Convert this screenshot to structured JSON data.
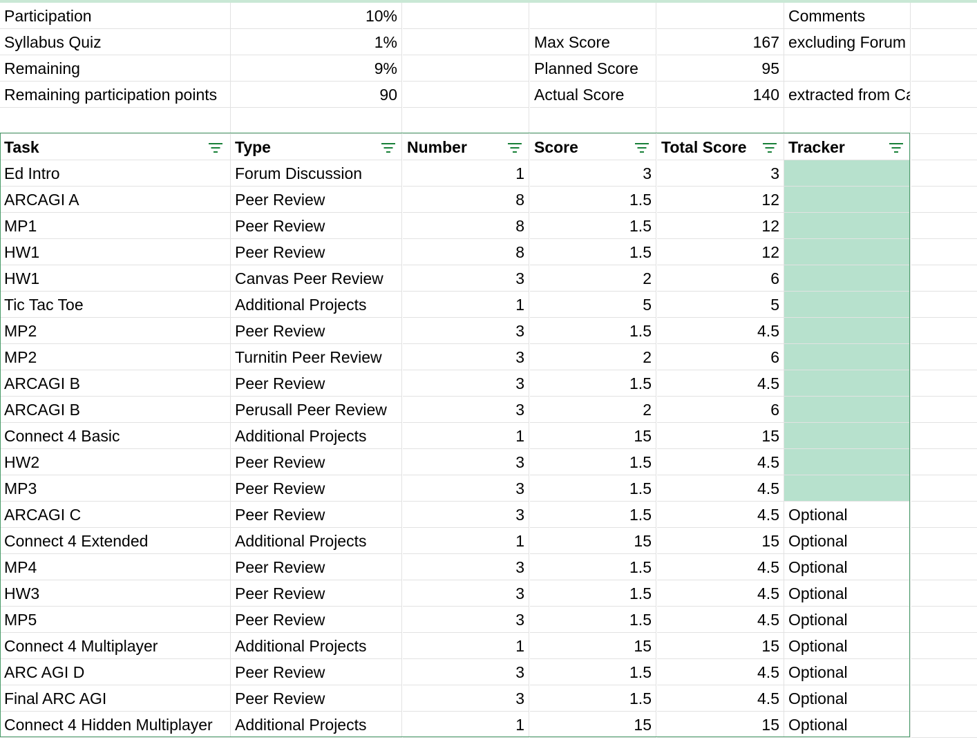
{
  "summary": {
    "rows": [
      {
        "a": "Participation",
        "b": "10%",
        "e": "",
        "f": "",
        "g": "Comments"
      },
      {
        "a": "Syllabus Quiz",
        "b": "1%",
        "e": "Max Score",
        "f": "167",
        "g": "excluding Forum posts"
      },
      {
        "a": "Remaining",
        "b": "9%",
        "e": "Planned Score",
        "f": "95",
        "g": ""
      },
      {
        "a": "Remaining participation points",
        "b": "90",
        "e": "Actual Score",
        "f": "140",
        "g": "extracted from Canvas"
      }
    ]
  },
  "table": {
    "headers": [
      "Task",
      "Type",
      "Number",
      "Score",
      "Total Score",
      "Tracker"
    ],
    "rows": [
      {
        "task": "Ed Intro",
        "type": "Forum Discussion",
        "number": "1",
        "score": "3",
        "total": "3",
        "tracker": "",
        "done": true
      },
      {
        "task": "ARCAGI A",
        "type": "Peer Review",
        "number": "8",
        "score": "1.5",
        "total": "12",
        "tracker": "",
        "done": true
      },
      {
        "task": "MP1",
        "type": "Peer Review",
        "number": "8",
        "score": "1.5",
        "total": "12",
        "tracker": "",
        "done": true
      },
      {
        "task": "HW1",
        "type": "Peer Review",
        "number": "8",
        "score": "1.5",
        "total": "12",
        "tracker": "",
        "done": true
      },
      {
        "task": "HW1",
        "type": "Canvas Peer Review",
        "number": "3",
        "score": "2",
        "total": "6",
        "tracker": "",
        "done": true
      },
      {
        "task": "Tic Tac Toe",
        "type": "Additional Projects",
        "number": "1",
        "score": "5",
        "total": "5",
        "tracker": "",
        "done": true
      },
      {
        "task": "MP2",
        "type": "Peer Review",
        "number": "3",
        "score": "1.5",
        "total": "4.5",
        "tracker": "",
        "done": true
      },
      {
        "task": "MP2",
        "type": "Turnitin Peer Review",
        "number": "3",
        "score": "2",
        "total": "6",
        "tracker": "",
        "done": true
      },
      {
        "task": "ARCAGI B",
        "type": "Peer Review",
        "number": "3",
        "score": "1.5",
        "total": "4.5",
        "tracker": "",
        "done": true
      },
      {
        "task": "ARCAGI B",
        "type": "Perusall Peer Review",
        "number": "3",
        "score": "2",
        "total": "6",
        "tracker": "",
        "done": true
      },
      {
        "task": "Connect 4 Basic",
        "type": "Additional Projects",
        "number": "1",
        "score": "15",
        "total": "15",
        "tracker": "",
        "done": true
      },
      {
        "task": "HW2",
        "type": "Peer Review",
        "number": "3",
        "score": "1.5",
        "total": "4.5",
        "tracker": "",
        "done": true
      },
      {
        "task": "MP3",
        "type": "Peer Review",
        "number": "3",
        "score": "1.5",
        "total": "4.5",
        "tracker": "",
        "done": true
      },
      {
        "task": "ARCAGI C",
        "type": "Peer Review",
        "number": "3",
        "score": "1.5",
        "total": "4.5",
        "tracker": "Optional",
        "done": false
      },
      {
        "task": "Connect 4 Extended",
        "type": "Additional Projects",
        "number": "1",
        "score": "15",
        "total": "15",
        "tracker": "Optional",
        "done": false
      },
      {
        "task": "MP4",
        "type": "Peer Review",
        "number": "3",
        "score": "1.5",
        "total": "4.5",
        "tracker": "Optional",
        "done": false
      },
      {
        "task": "HW3",
        "type": "Peer Review",
        "number": "3",
        "score": "1.5",
        "total": "4.5",
        "tracker": "Optional",
        "done": false
      },
      {
        "task": "MP5",
        "type": "Peer Review",
        "number": "3",
        "score": "1.5",
        "total": "4.5",
        "tracker": "Optional",
        "done": false
      },
      {
        "task": "Connect 4 Multiplayer",
        "type": "Additional Projects",
        "number": "1",
        "score": "15",
        "total": "15",
        "tracker": "Optional",
        "done": false
      },
      {
        "task": "ARC AGI D",
        "type": "Peer Review",
        "number": "3",
        "score": "1.5",
        "total": "4.5",
        "tracker": "Optional",
        "done": false
      },
      {
        "task": "Final ARC AGI",
        "type": "Peer Review",
        "number": "3",
        "score": "1.5",
        "total": "4.5",
        "tracker": "Optional",
        "done": false
      },
      {
        "task": "Connect 4 Hidden Multiplayer",
        "type": "Additional Projects",
        "number": "1",
        "score": "15",
        "total": "15",
        "tracker": "Optional",
        "done": false
      }
    ]
  },
  "colors": {
    "tracker_fill": "#b7e1cd",
    "filter_icon": "#188038",
    "gridline": "#e2e2e2",
    "table_border": "#4a9b6a"
  },
  "icons": {
    "filter": "filter-icon"
  }
}
